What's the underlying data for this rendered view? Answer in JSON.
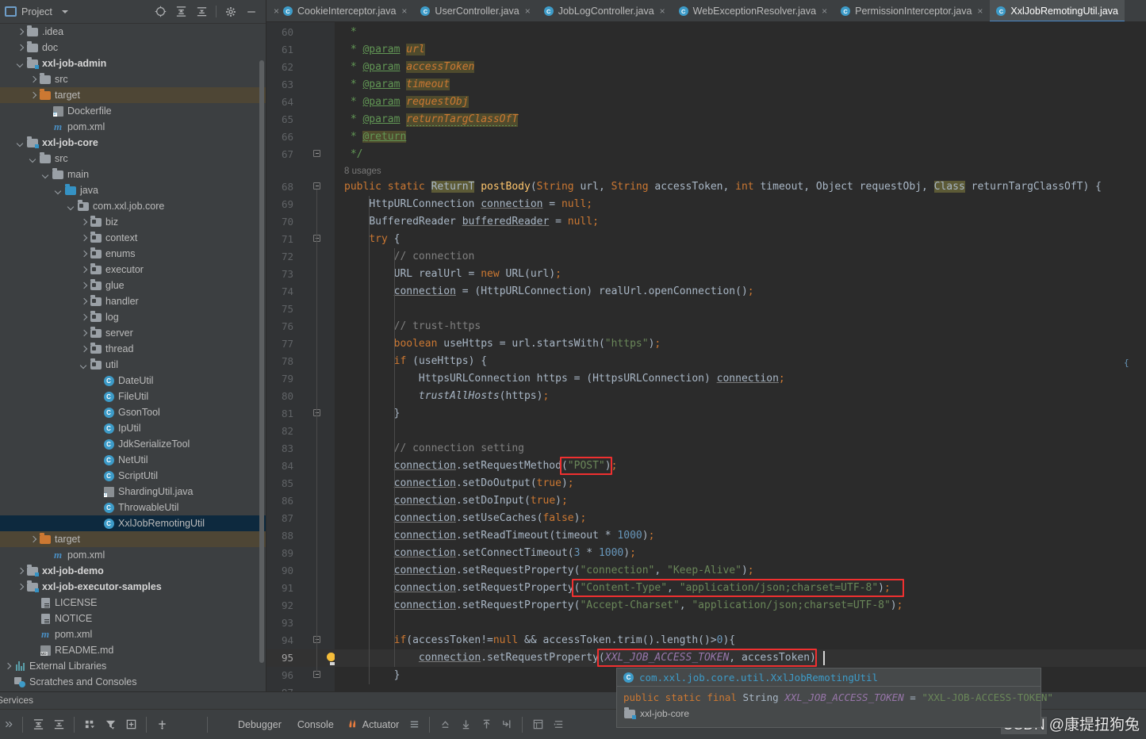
{
  "window": {
    "ide": "IntelliJ IDEA"
  },
  "project_panel": {
    "title": "Project",
    "tools": [
      {
        "name": "select-opened-file-icon",
        "label": "⊕"
      },
      {
        "name": "expand-all-icon",
        "label": "expand"
      },
      {
        "name": "collapse-all-icon",
        "label": "collapse"
      },
      {
        "name": "settings-gear-icon",
        "label": "gear"
      },
      {
        "name": "hide-panel-icon",
        "label": "—"
      }
    ],
    "tree": [
      {
        "label": ".idea",
        "indent": 1,
        "arrow": "right",
        "icon": "folder-grey",
        "bold": false
      },
      {
        "label": "doc",
        "indent": 1,
        "arrow": "right",
        "icon": "folder-grey",
        "bold": false
      },
      {
        "label": "xxl-job-admin",
        "indent": 1,
        "arrow": "down",
        "icon": "module",
        "bold": true
      },
      {
        "label": "src",
        "indent": 2,
        "arrow": "right",
        "icon": "folder-grey",
        "bold": false
      },
      {
        "label": "target",
        "indent": 2,
        "arrow": "right",
        "icon": "folder-orange",
        "bold": false,
        "sel": "amber"
      },
      {
        "label": "Dockerfile",
        "indent": 3,
        "arrow": "none",
        "icon": "docker",
        "bold": false
      },
      {
        "label": "pom.xml",
        "indent": 3,
        "arrow": "none",
        "icon": "maven",
        "bold": false
      },
      {
        "label": "xxl-job-core",
        "indent": 1,
        "arrow": "down",
        "icon": "module",
        "bold": true
      },
      {
        "label": "src",
        "indent": 2,
        "arrow": "down",
        "icon": "folder-grey",
        "bold": false
      },
      {
        "label": "main",
        "indent": 3,
        "arrow": "down",
        "icon": "folder-grey",
        "bold": false
      },
      {
        "label": "java",
        "indent": 4,
        "arrow": "down",
        "icon": "folder-blue",
        "bold": false
      },
      {
        "label": "com.xxl.job.core",
        "indent": 5,
        "arrow": "down",
        "icon": "package",
        "bold": false
      },
      {
        "label": "biz",
        "indent": 6,
        "arrow": "right",
        "icon": "package",
        "bold": false
      },
      {
        "label": "context",
        "indent": 6,
        "arrow": "right",
        "icon": "package",
        "bold": false
      },
      {
        "label": "enums",
        "indent": 6,
        "arrow": "right",
        "icon": "package",
        "bold": false
      },
      {
        "label": "executor",
        "indent": 6,
        "arrow": "right",
        "icon": "package",
        "bold": false
      },
      {
        "label": "glue",
        "indent": 6,
        "arrow": "right",
        "icon": "package",
        "bold": false
      },
      {
        "label": "handler",
        "indent": 6,
        "arrow": "right",
        "icon": "package",
        "bold": false
      },
      {
        "label": "log",
        "indent": 6,
        "arrow": "right",
        "icon": "package",
        "bold": false
      },
      {
        "label": "server",
        "indent": 6,
        "arrow": "right",
        "icon": "package",
        "bold": false
      },
      {
        "label": "thread",
        "indent": 6,
        "arrow": "right",
        "icon": "package",
        "bold": false
      },
      {
        "label": "util",
        "indent": 6,
        "arrow": "down",
        "icon": "package",
        "bold": false
      },
      {
        "label": "DateUtil",
        "indent": 7,
        "arrow": "none",
        "icon": "class",
        "bold": false
      },
      {
        "label": "FileUtil",
        "indent": 7,
        "arrow": "none",
        "icon": "class",
        "bold": false
      },
      {
        "label": "GsonTool",
        "indent": 7,
        "arrow": "none",
        "icon": "class",
        "bold": false
      },
      {
        "label": "IpUtil",
        "indent": 7,
        "arrow": "none",
        "icon": "class",
        "bold": false
      },
      {
        "label": "JdkSerializeTool",
        "indent": 7,
        "arrow": "none",
        "icon": "class",
        "bold": false
      },
      {
        "label": "NetUtil",
        "indent": 7,
        "arrow": "none",
        "icon": "class",
        "bold": false
      },
      {
        "label": "ScriptUtil",
        "indent": 7,
        "arrow": "none",
        "icon": "class",
        "bold": false
      },
      {
        "label": "ShardingUtil.java",
        "indent": 7,
        "arrow": "none",
        "icon": "javafile",
        "bold": false
      },
      {
        "label": "ThrowableUtil",
        "indent": 7,
        "arrow": "none",
        "icon": "class",
        "bold": false
      },
      {
        "label": "XxlJobRemotingUtil",
        "indent": 7,
        "arrow": "none",
        "icon": "class",
        "bold": false,
        "sel": "blue"
      },
      {
        "label": "target",
        "indent": 2,
        "arrow": "right",
        "icon": "folder-orange",
        "bold": false,
        "sel": "amber"
      },
      {
        "label": "pom.xml",
        "indent": 3,
        "arrow": "none",
        "icon": "maven",
        "bold": false
      },
      {
        "label": "xxl-job-demo",
        "indent": 1,
        "arrow": "right",
        "icon": "module",
        "bold": true
      },
      {
        "label": "xxl-job-executor-samples",
        "indent": 1,
        "arrow": "right",
        "icon": "module",
        "bold": true
      },
      {
        "label": "LICENSE",
        "indent": 2,
        "arrow": "none",
        "icon": "textfile",
        "bold": false
      },
      {
        "label": "NOTICE",
        "indent": 2,
        "arrow": "none",
        "icon": "textfile",
        "bold": false
      },
      {
        "label": "pom.xml",
        "indent": 2,
        "arrow": "none",
        "icon": "maven",
        "bold": false
      },
      {
        "label": "README.md",
        "indent": 2,
        "arrow": "none",
        "icon": "markdown",
        "bold": false
      },
      {
        "label": "External Libraries",
        "indent": 0,
        "arrow": "right",
        "icon": "libraries",
        "bold": false
      },
      {
        "label": "Scratches and Consoles",
        "indent": 0,
        "arrow": "none",
        "icon": "scratches",
        "bold": false
      }
    ]
  },
  "tabs": [
    {
      "label": "CookieInterceptor.java",
      "active": false
    },
    {
      "label": "UserController.java",
      "active": false
    },
    {
      "label": "JobLogController.java",
      "active": false
    },
    {
      "label": "WebExceptionResolver.java",
      "active": false
    },
    {
      "label": "PermissionInterceptor.java",
      "active": false
    },
    {
      "label": "XxlJobRemotingUtil.java",
      "active": true
    }
  ],
  "editor": {
    "first_line": 60,
    "current_line": 95,
    "usages_hint": "8 usages",
    "lines": [
      {
        "n": 60,
        "text": " *"
      },
      {
        "n": 61,
        "text": " * @param url"
      },
      {
        "n": 62,
        "text": " * @param accessToken"
      },
      {
        "n": 63,
        "text": " * @param timeout"
      },
      {
        "n": 64,
        "text": " * @param requestObj"
      },
      {
        "n": 65,
        "text": " * @param returnTargClassOfT"
      },
      {
        "n": 66,
        "text": " * @return"
      },
      {
        "n": 67,
        "text": " */"
      },
      {
        "n": 68,
        "text": "public static ReturnT postBody(String url, String accessToken, int timeout, Object requestObj, Class returnTargClassOfT) {"
      },
      {
        "n": 69,
        "text": "    HttpURLConnection connection = null;"
      },
      {
        "n": 70,
        "text": "    BufferedReader bufferedReader = null;"
      },
      {
        "n": 71,
        "text": "    try {"
      },
      {
        "n": 72,
        "text": "        // connection"
      },
      {
        "n": 73,
        "text": "        URL realUrl = new URL(url);"
      },
      {
        "n": 74,
        "text": "        connection = (HttpURLConnection) realUrl.openConnection();"
      },
      {
        "n": 75,
        "text": ""
      },
      {
        "n": 76,
        "text": "        // trust-https"
      },
      {
        "n": 77,
        "text": "        boolean useHttps = url.startsWith(\"https\");"
      },
      {
        "n": 78,
        "text": "        if (useHttps) {"
      },
      {
        "n": 79,
        "text": "            HttpsURLConnection https = (HttpsURLConnection) connection;"
      },
      {
        "n": 80,
        "text": "            trustAllHosts(https);"
      },
      {
        "n": 81,
        "text": "        }"
      },
      {
        "n": 82,
        "text": ""
      },
      {
        "n": 83,
        "text": "        // connection setting"
      },
      {
        "n": 84,
        "text": "        connection.setRequestMethod(\"POST\");"
      },
      {
        "n": 85,
        "text": "        connection.setDoOutput(true);"
      },
      {
        "n": 86,
        "text": "        connection.setDoInput(true);"
      },
      {
        "n": 87,
        "text": "        connection.setUseCaches(false);"
      },
      {
        "n": 88,
        "text": "        connection.setReadTimeout(timeout * 1000);"
      },
      {
        "n": 89,
        "text": "        connection.setConnectTimeout(3 * 1000);"
      },
      {
        "n": 90,
        "text": "        connection.setRequestProperty(\"connection\", \"Keep-Alive\");"
      },
      {
        "n": 91,
        "text": "        connection.setRequestProperty(\"Content-Type\", \"application/json;charset=UTF-8\");"
      },
      {
        "n": 92,
        "text": "        connection.setRequestProperty(\"Accept-Charset\", \"application/json;charset=UTF-8\");"
      },
      {
        "n": 93,
        "text": ""
      },
      {
        "n": 94,
        "text": "        if(accessToken!=null && accessToken.trim().length()>0){"
      },
      {
        "n": 95,
        "text": "            connection.setRequestProperty(XXL_JOB_ACCESS_TOKEN, accessToken)"
      },
      {
        "n": 96,
        "text": "        }"
      },
      {
        "n": 97,
        "text": ""
      }
    ],
    "annotations": [
      {
        "name": "highlight-post-method",
        "label": "\"POST\""
      },
      {
        "name": "highlight-content-type",
        "label": "(\"Content-Type\", \"application/json;charset=UTF-8\");"
      },
      {
        "name": "highlight-access-token",
        "label": "(XXL_JOB_ACCESS_TOKEN, accessToken)"
      }
    ]
  },
  "completion": {
    "item_label": "com.xxl.job.core.util.XxlJobRemotingUtil",
    "signature": {
      "modifiers": "public static final",
      "type": "String",
      "name": "XXL_JOB_ACCESS_TOKEN",
      "equals": "=",
      "value": "\"XXL-JOB-ACCESS-TOKEN\""
    },
    "module": "xxl-job-core"
  },
  "bottom": {
    "services_label": "Services",
    "tabs": [
      "Debugger",
      "Console"
    ],
    "actuator_label": "Actuator"
  },
  "watermark": {
    "brand": "CSDN",
    "user": "@康提扭狗兔"
  }
}
